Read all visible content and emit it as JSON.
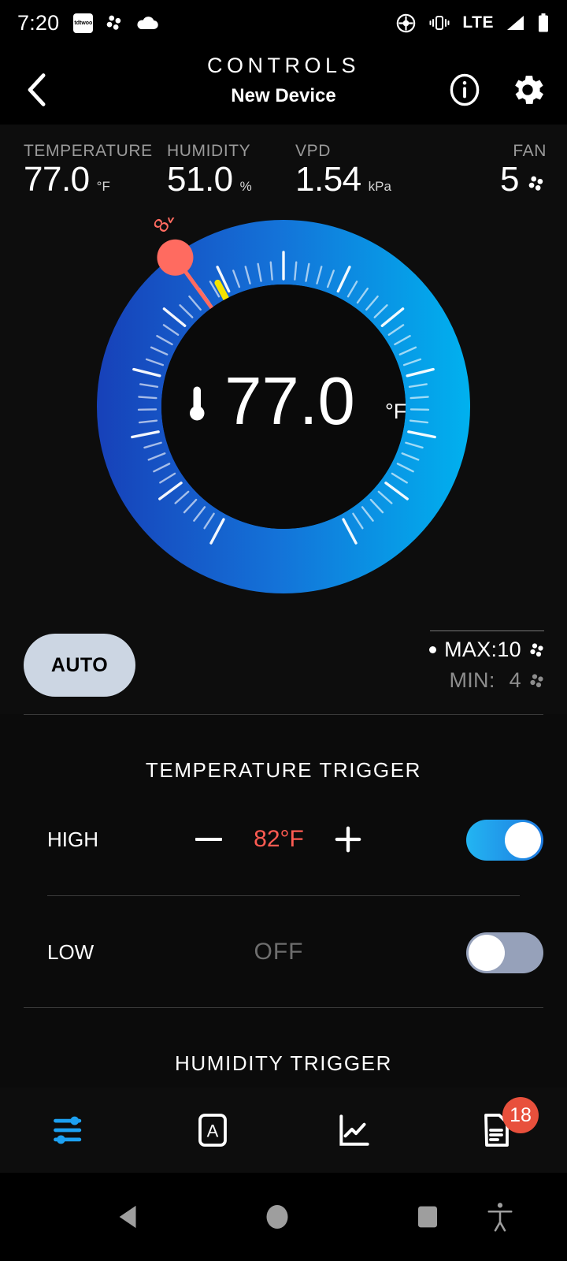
{
  "statusbar": {
    "time": "7:20",
    "app_badge_text": "tdtwoo",
    "icons_left": [
      "app-icon",
      "fan-icon",
      "cloud-icon"
    ],
    "lte_label": "LTE",
    "icons_right": [
      "location-icon",
      "vibrate-icon",
      "signal-icon",
      "battery-icon"
    ]
  },
  "header": {
    "title": "CONTROLS",
    "device_name": "New Device",
    "back_icon": "chevron-left-icon",
    "info_icon": "info-icon",
    "settings_icon": "gear-icon"
  },
  "readouts": [
    {
      "label": "TEMPERATURE",
      "value": "77.0",
      "unit": "°F"
    },
    {
      "label": "HUMIDITY",
      "value": "51.0",
      "unit": "%"
    },
    {
      "label": "VPD",
      "value": "1.54",
      "unit": "kPa"
    },
    {
      "label": "FAN",
      "value": "5",
      "unit": "fan-icon"
    }
  ],
  "gauge": {
    "center_value": "77.0",
    "center_unit": "°F",
    "center_icon": "thermometer-icon",
    "marker_label": "82°F",
    "marker_color": "#ff6b60",
    "needle_color": "#f5e400",
    "ring_color_start": "#1740b8",
    "ring_color_end": "#00b2ef",
    "outer_ring_color": "#b9b9b9",
    "scale_min": 32,
    "scale_max": 122,
    "current_reading": 77.0,
    "trigger_reading": 82.0
  },
  "controls": {
    "auto_label": "AUTO",
    "max_label": "MAX:",
    "max_value": "10",
    "min_label": "MIN:",
    "min_value": "4",
    "fan_icon": "fan-icon"
  },
  "temperature_trigger": {
    "section_title": "TEMPERATURE TRIGGER",
    "high": {
      "label": "HIGH",
      "value": "82°F",
      "minus_icon": "minus-icon",
      "plus_icon": "plus-icon",
      "toggle_state": "on"
    },
    "low": {
      "label": "LOW",
      "value": "OFF",
      "toggle_state": "off"
    }
  },
  "humidity_trigger": {
    "section_title": "HUMIDITY TRIGGER"
  },
  "tabbar": {
    "items": [
      {
        "name": "controls-tab",
        "icon": "sliders-icon",
        "active": true
      },
      {
        "name": "auto-tab",
        "icon": "letter-a-box-icon",
        "active": false
      },
      {
        "name": "chart-tab",
        "icon": "line-chart-icon",
        "active": false
      },
      {
        "name": "log-tab",
        "icon": "document-icon",
        "active": false,
        "badge": "18"
      }
    ],
    "active_color": "#1da1f2",
    "badge_color": "#e8503c"
  },
  "navbar": {
    "back_icon": "triangle-back-icon",
    "home_icon": "circle-home-icon",
    "recents_icon": "square-recents-icon",
    "accessibility_icon": "accessibility-icon"
  }
}
